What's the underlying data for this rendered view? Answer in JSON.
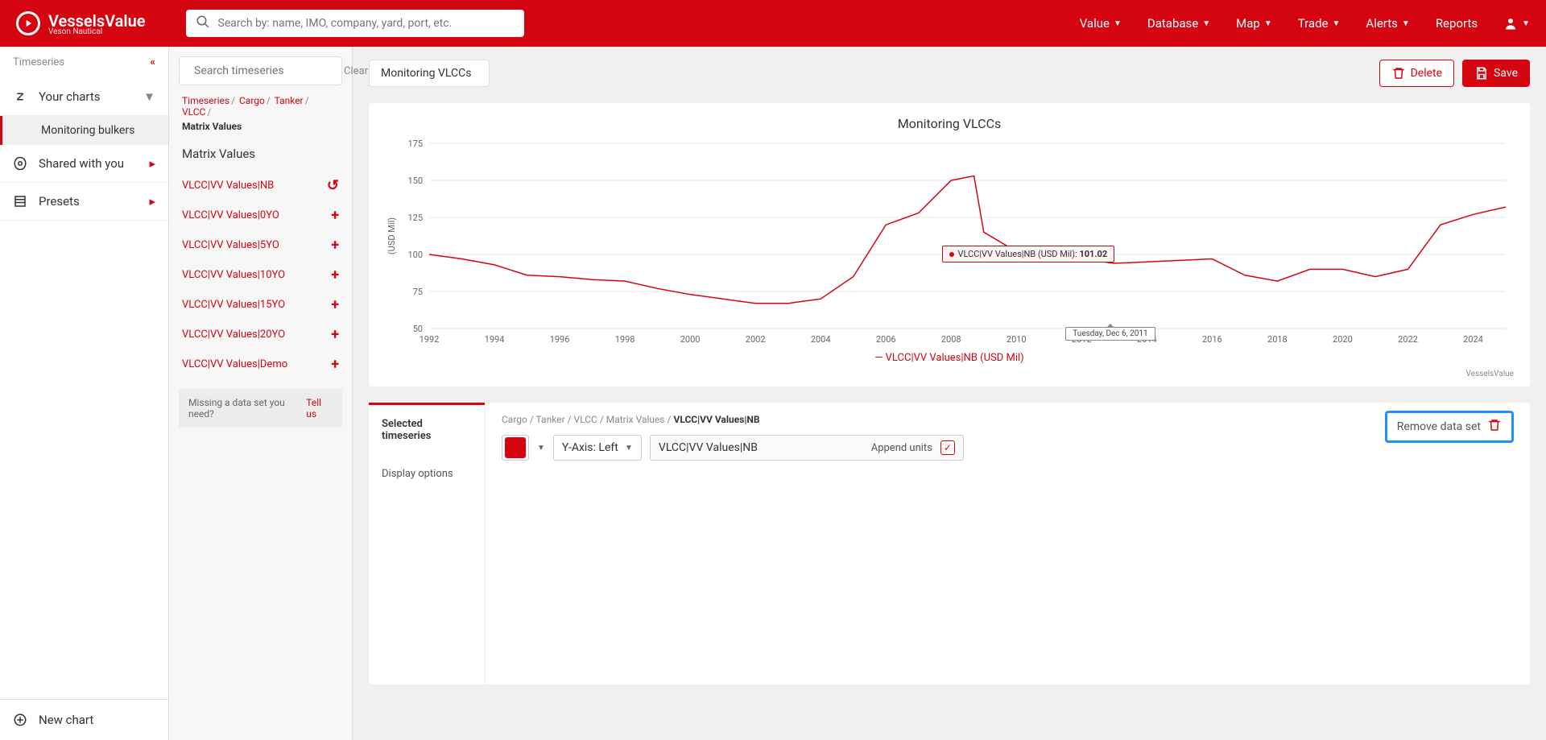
{
  "header": {
    "brand": "VesselsValue",
    "brand_sub": "Veson Nautical",
    "search_placeholder": "Search by: name, IMO, company, yard, port, etc.",
    "nav": [
      "Value",
      "Database",
      "Map",
      "Trade",
      "Alerts",
      "Reports"
    ]
  },
  "sidebar": {
    "title": "Timeseries",
    "sections": {
      "your_charts": "Your charts",
      "monitoring_bulkers": "Monitoring bulkers",
      "shared": "Shared with you",
      "presets": "Presets"
    },
    "new_chart": "New chart"
  },
  "ts_panel": {
    "search_placeholder": "Search timeseries",
    "clear": "Clear",
    "breadcrumb": [
      "Timeseries",
      "Cargo",
      "Tanker",
      "VLCC"
    ],
    "breadcrumb_last": "Matrix Values",
    "title": "Matrix Values",
    "items": [
      {
        "label": "VLCC|VV Values|NB",
        "action": "undo"
      },
      {
        "label": "VLCC|VV Values|0YO",
        "action": "plus"
      },
      {
        "label": "VLCC|VV Values|5YO",
        "action": "plus"
      },
      {
        "label": "VLCC|VV Values|10YO",
        "action": "plus"
      },
      {
        "label": "VLCC|VV Values|15YO",
        "action": "plus"
      },
      {
        "label": "VLCC|VV Values|20YO",
        "action": "plus"
      },
      {
        "label": "VLCC|VV Values|Demo",
        "action": "plus"
      }
    ],
    "missing": "Missing a data set you need?",
    "tell_us": "Tell us"
  },
  "main": {
    "chart_name": "Monitoring VLCCs",
    "delete": "Delete",
    "save": "Save"
  },
  "chart": {
    "title": "Monitoring VLCCs",
    "legend": "VLCC|VV Values|NB (USD Mil)",
    "ylabel": "(USD Mil)",
    "attribution": "VesselsValue",
    "tooltip_series": "VLCC|VV Values|NB (USD Mil): ",
    "tooltip_value": "101.02",
    "tooltip_date": "Tuesday, Dec 6, 2011"
  },
  "bottom": {
    "tab_selected": "Selected timeseries",
    "tab_display": "Display options",
    "crumb": "Cargo / Tanker / VLCC / Matrix Values / ",
    "crumb_last": "VLCC|VV Values|NB",
    "yaxis": "Y-Axis: Left",
    "series_name": "VLCC|VV Values|NB",
    "append": "Append units",
    "remove": "Remove data set"
  },
  "chart_data": {
    "type": "line",
    "title": "Monitoring VLCCs",
    "xlabel": "",
    "ylabel": "(USD Mil)",
    "ylim": [
      50,
      175
    ],
    "x_ticks": [
      1992,
      1994,
      1996,
      1998,
      2000,
      2002,
      2004,
      2006,
      2008,
      2010,
      2012,
      2014,
      2016,
      2018,
      2020,
      2022,
      2024
    ],
    "y_ticks": [
      50,
      75,
      100,
      125,
      150,
      175
    ],
    "series": [
      {
        "name": "VLCC|VV Values|NB (USD Mil)",
        "color": "#d40511",
        "x": [
          1992,
          1993,
          1994,
          1995,
          1996,
          1997,
          1998,
          1999,
          2000,
          2001,
          2002,
          2003,
          2004,
          2005,
          2006,
          2007,
          2008,
          2008.7,
          2009,
          2010,
          2011,
          2011.93,
          2012,
          2013,
          2014,
          2015,
          2016,
          2017,
          2018,
          2019,
          2020,
          2021,
          2022,
          2023,
          2024,
          2025
        ],
        "values": [
          100,
          97,
          93,
          86,
          85,
          83,
          82,
          77,
          73,
          70,
          67,
          67,
          70,
          85,
          120,
          128,
          150,
          153,
          115,
          102,
          101,
          101.02,
          97,
          94,
          95,
          96,
          97,
          86,
          82,
          90,
          90,
          85,
          90,
          120,
          127,
          132
        ]
      }
    ],
    "highlight_point": {
      "x": 2011.93,
      "y": 101.02,
      "date": "Tuesday, Dec 6, 2011"
    }
  }
}
